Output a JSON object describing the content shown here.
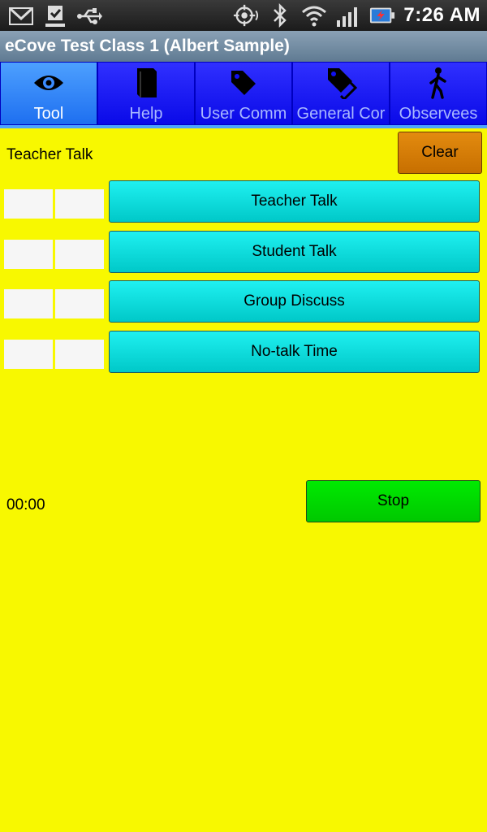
{
  "status_bar": {
    "left_icons": [
      "gmail-icon",
      "download-done-icon",
      "usb-icon"
    ],
    "right_icons": [
      "gps-icon",
      "bluetooth-icon",
      "wifi-icon",
      "signal-icon",
      "battery-charging-icon"
    ],
    "time": "7:26 AM"
  },
  "app": {
    "title": "eCove Test Class 1 (Albert Sample)"
  },
  "tabs": [
    {
      "label": "Tool",
      "icon": "eye-icon",
      "active": true
    },
    {
      "label": "Help",
      "icon": "book-icon",
      "active": false
    },
    {
      "label": "User Comm",
      "icon": "tag-icon",
      "active": false
    },
    {
      "label": "General Cor",
      "icon": "tags-icon",
      "active": false
    },
    {
      "label": "Observees",
      "icon": "walking-person-icon",
      "active": false
    }
  ],
  "tool": {
    "current_code": "Teacher Talk",
    "clear_label": "Clear",
    "codes": [
      {
        "label": "Teacher Talk",
        "count": "",
        "time": ""
      },
      {
        "label": "Student Talk",
        "count": "",
        "time": ""
      },
      {
        "label": "Group Discuss",
        "count": "",
        "time": ""
      },
      {
        "label": "No-talk Time",
        "count": "",
        "time": ""
      }
    ],
    "timer": "00:00",
    "stop_label": "Stop"
  },
  "colors": {
    "background": "#f8f800",
    "tab_bg": "#1010f0",
    "tab_active": "#3b8cff",
    "code_button": "#00dede",
    "clear_button": "#d57d05",
    "stop_button": "#00d800"
  }
}
